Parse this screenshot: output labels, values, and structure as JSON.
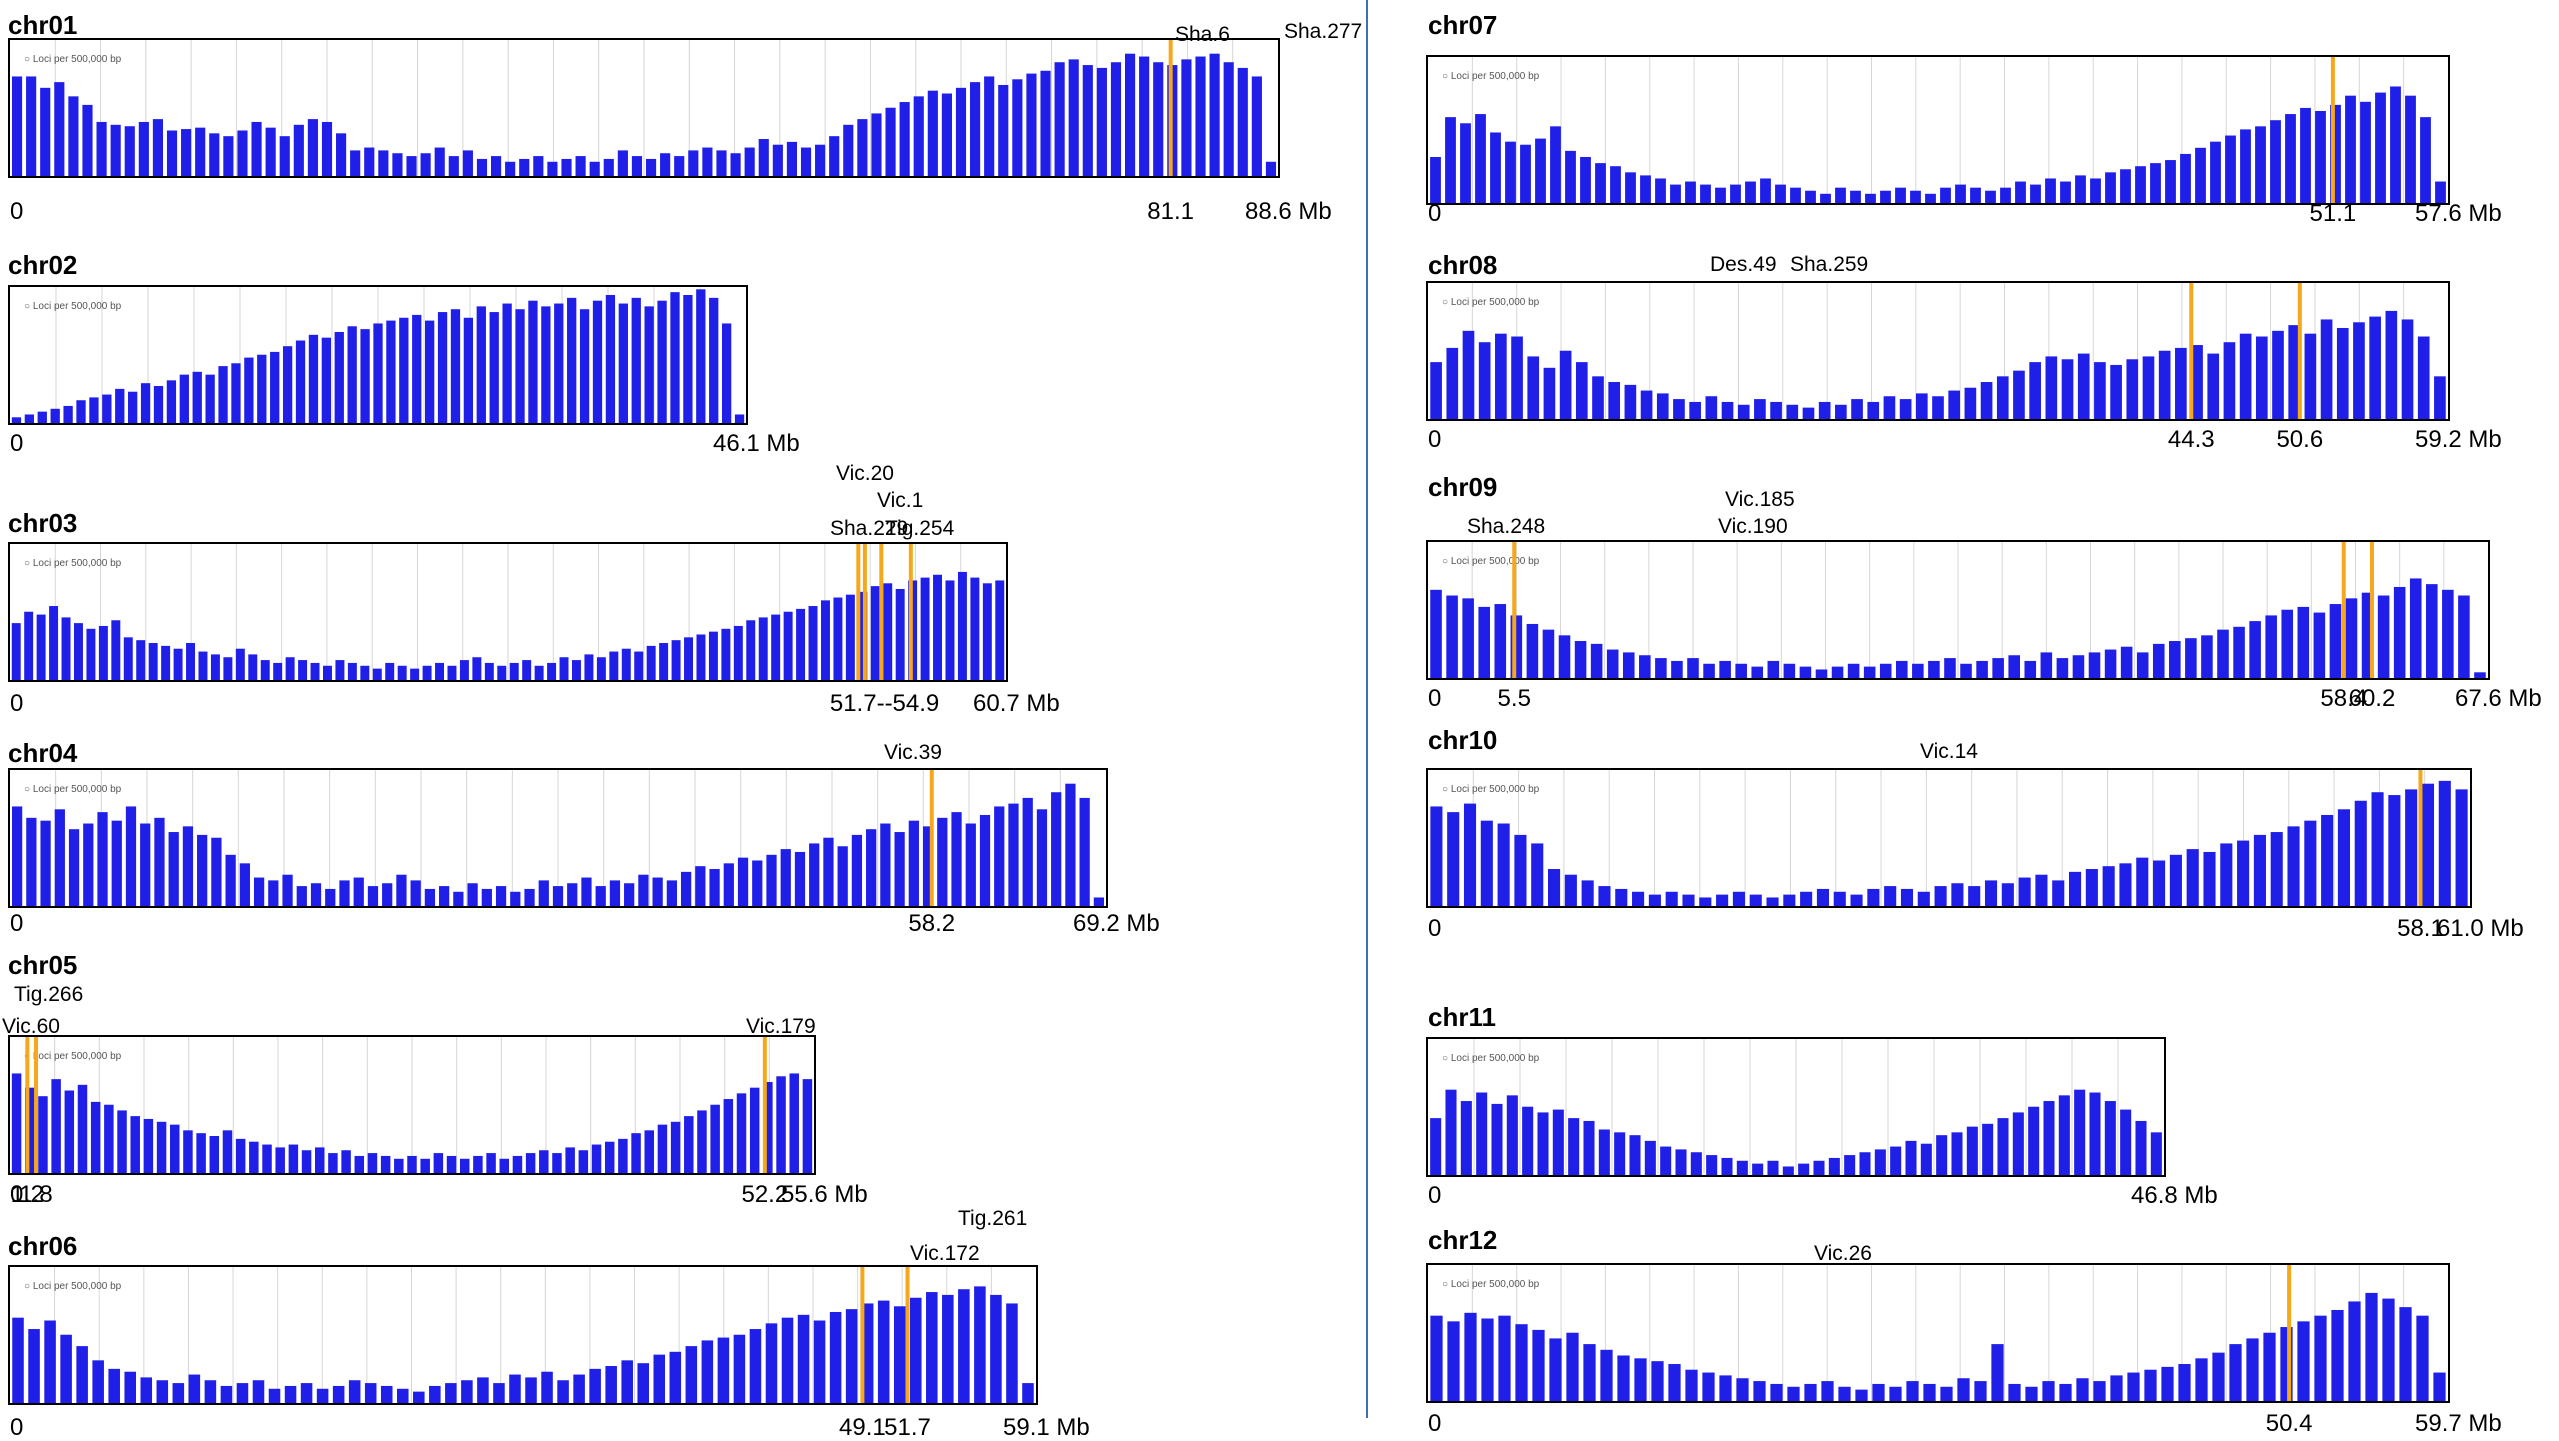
{
  "colors": {
    "bar": "#1f1fe8",
    "marker": "#f5a81c",
    "frame": "#000000",
    "grid": "#d6d6d6",
    "divider": "#3b6fb6"
  },
  "legend_text": "Loci per 500,000 bp",
  "unit": "Mb",
  "chart_data": [
    {
      "id": "chr01",
      "type": "bar",
      "title": "chr01",
      "length_mb": 88.6,
      "ticks": [
        "0",
        "81.1",
        "88.6 Mb"
      ],
      "tick_values": [
        0,
        81.1,
        88.6
      ],
      "markers": [
        {
          "label": "Sha.6",
          "position_mb": 81.1
        }
      ],
      "values": [
        70,
        70,
        62,
        66,
        56,
        50,
        38,
        36,
        35,
        38,
        40,
        32,
        33,
        34,
        30,
        28,
        32,
        38,
        34,
        28,
        36,
        40,
        38,
        30,
        18,
        20,
        18,
        16,
        14,
        16,
        20,
        14,
        18,
        12,
        14,
        10,
        12,
        14,
        10,
        12,
        14,
        10,
        12,
        18,
        14,
        12,
        16,
        14,
        18,
        20,
        18,
        16,
        20,
        26,
        22,
        24,
        20,
        22,
        28,
        36,
        40,
        44,
        48,
        52,
        56,
        60,
        58,
        62,
        66,
        70,
        64,
        68,
        72,
        74,
        80,
        82,
        78,
        76,
        80,
        86,
        84,
        80,
        78,
        82,
        84,
        86,
        80,
        76,
        70,
        10
      ]
    },
    {
      "id": "chr02",
      "type": "bar",
      "title": "chr02",
      "length_mb": 46.1,
      "ticks": [
        "0",
        "46.1 Mb"
      ],
      "tick_values": [
        0,
        46.1
      ],
      "markers": [],
      "values": [
        4,
        6,
        8,
        10,
        12,
        16,
        18,
        20,
        24,
        22,
        28,
        26,
        30,
        34,
        36,
        34,
        40,
        42,
        46,
        48,
        50,
        54,
        58,
        62,
        60,
        64,
        68,
        66,
        70,
        72,
        74,
        76,
        72,
        78,
        80,
        74,
        82,
        78,
        84,
        80,
        86,
        82,
        84,
        88,
        80,
        86,
        90,
        84,
        88,
        82,
        86,
        92,
        90,
        94,
        88,
        70,
        6
      ]
    },
    {
      "id": "chr03",
      "type": "bar",
      "title": "chr03",
      "length_mb": 60.7,
      "ticks": [
        "0",
        "51.7--54.9",
        "60.7 Mb"
      ],
      "tick_values": [
        0,
        53.3,
        60.7
      ],
      "markers": [
        {
          "label": "Vic.20",
          "position_mb": 51.7
        },
        {
          "label": "Vic.1",
          "position_mb": 52.1
        },
        {
          "label": "Sha.229",
          "position_mb": 53.1
        },
        {
          "label": "Tig.254",
          "position_mb": 54.9
        }
      ],
      "values": [
        40,
        48,
        46,
        52,
        44,
        40,
        36,
        38,
        42,
        30,
        28,
        26,
        24,
        22,
        26,
        20,
        18,
        16,
        22,
        18,
        14,
        12,
        16,
        14,
        12,
        10,
        14,
        12,
        10,
        8,
        12,
        10,
        8,
        10,
        12,
        10,
        14,
        16,
        12,
        10,
        12,
        14,
        10,
        12,
        16,
        14,
        18,
        16,
        20,
        22,
        20,
        24,
        26,
        28,
        30,
        32,
        34,
        36,
        38,
        42,
        44,
        46,
        48,
        50,
        52,
        56,
        58,
        60,
        62,
        66,
        68,
        64,
        70,
        72,
        74,
        70,
        76,
        72,
        68,
        70
      ]
    },
    {
      "id": "chr04",
      "type": "bar",
      "title": "chr04",
      "length_mb": 69.2,
      "ticks": [
        "0",
        "58.2",
        "69.2 Mb"
      ],
      "tick_values": [
        0,
        58.2,
        69.2
      ],
      "markers": [
        {
          "label": "Vic.39",
          "position_mb": 58.2
        }
      ],
      "values": [
        70,
        62,
        60,
        68,
        54,
        58,
        66,
        60,
        70,
        58,
        62,
        52,
        56,
        50,
        48,
        36,
        30,
        20,
        18,
        22,
        14,
        16,
        12,
        18,
        20,
        14,
        16,
        22,
        18,
        12,
        14,
        10,
        16,
        12,
        14,
        10,
        12,
        18,
        14,
        16,
        20,
        14,
        18,
        16,
        22,
        20,
        18,
        24,
        28,
        26,
        30,
        34,
        32,
        36,
        40,
        38,
        44,
        48,
        42,
        50,
        54,
        58,
        52,
        60,
        56,
        62,
        66,
        58,
        64,
        70,
        72,
        76,
        68,
        80,
        86,
        76,
        6
      ]
    },
    {
      "id": "chr05",
      "type": "bar",
      "title": "chr05",
      "length_mb": 55.6,
      "ticks": [
        "0",
        "1.2",
        "1.8",
        "52.2",
        "55.6 Mb"
      ],
      "tick_values": [
        0,
        1.2,
        1.8,
        52.2,
        55.6
      ],
      "markers": [
        {
          "label": "Vic.60",
          "position_mb": 1.2
        },
        {
          "label": "Tig.266",
          "position_mb": 1.8
        },
        {
          "label": "Vic.179",
          "position_mb": 52.2
        }
      ],
      "values": [
        70,
        60,
        54,
        66,
        58,
        62,
        50,
        48,
        44,
        40,
        38,
        36,
        34,
        30,
        28,
        26,
        30,
        24,
        22,
        20,
        18,
        20,
        16,
        18,
        14,
        16,
        12,
        14,
        12,
        10,
        12,
        10,
        14,
        12,
        10,
        12,
        14,
        10,
        12,
        14,
        16,
        14,
        18,
        16,
        20,
        22,
        24,
        28,
        30,
        34,
        36,
        40,
        44,
        48,
        52,
        56,
        60,
        64,
        68,
        70,
        66
      ]
    },
    {
      "id": "chr06",
      "type": "bar",
      "title": "chr06",
      "length_mb": 59.1,
      "ticks": [
        "0",
        "49.1",
        "51.7",
        "59.1 Mb"
      ],
      "tick_values": [
        0,
        49.1,
        51.7,
        59.1
      ],
      "markers": [
        {
          "label": "Vic.172",
          "position_mb": 49.1
        },
        {
          "label": "Tig.261",
          "position_mb": 51.7
        }
      ],
      "values": [
        60,
        52,
        58,
        48,
        40,
        30,
        24,
        22,
        18,
        16,
        14,
        20,
        16,
        12,
        14,
        16,
        10,
        12,
        14,
        10,
        12,
        16,
        14,
        12,
        10,
        8,
        12,
        14,
        16,
        18,
        14,
        20,
        18,
        22,
        16,
        20,
        24,
        26,
        30,
        28,
        34,
        36,
        40,
        44,
        46,
        48,
        52,
        56,
        60,
        62,
        58,
        64,
        66,
        70,
        72,
        68,
        74,
        78,
        76,
        80,
        82,
        76,
        70,
        14
      ]
    },
    {
      "id": "chr07",
      "type": "bar",
      "title": "chr07",
      "length_mb": 57.6,
      "ticks": [
        "0",
        "51.1",
        "57.6 Mb"
      ],
      "tick_values": [
        0,
        51.1,
        57.6
      ],
      "markers": [
        {
          "label": "Sha.277",
          "position_mb": 51.1
        }
      ],
      "values": [
        30,
        56,
        52,
        58,
        46,
        40,
        38,
        42,
        50,
        34,
        30,
        26,
        24,
        20,
        18,
        16,
        12,
        14,
        12,
        10,
        12,
        14,
        16,
        12,
        10,
        8,
        6,
        10,
        8,
        6,
        8,
        10,
        8,
        6,
        10,
        12,
        10,
        8,
        10,
        14,
        12,
        16,
        14,
        18,
        16,
        20,
        22,
        24,
        26,
        28,
        32,
        36,
        40,
        44,
        48,
        50,
        54,
        58,
        62,
        60,
        64,
        70,
        66,
        72,
        76,
        70,
        56,
        14
      ]
    },
    {
      "id": "chr08",
      "type": "bar",
      "title": "chr08",
      "length_mb": 59.2,
      "ticks": [
        "0",
        "44.3",
        "50.6",
        "59.2 Mb"
      ],
      "tick_values": [
        0,
        44.3,
        50.6,
        59.2
      ],
      "markers": [
        {
          "label": "Des.49",
          "position_mb": 44.3
        },
        {
          "label": "Sha.259",
          "position_mb": 50.6
        }
      ],
      "values": [
        40,
        50,
        62,
        54,
        60,
        58,
        44,
        36,
        48,
        40,
        30,
        26,
        24,
        20,
        18,
        14,
        12,
        16,
        12,
        10,
        14,
        12,
        10,
        8,
        12,
        10,
        14,
        12,
        16,
        14,
        18,
        16,
        20,
        22,
        26,
        30,
        34,
        40,
        44,
        42,
        46,
        40,
        38,
        42,
        44,
        48,
        50,
        52,
        46,
        54,
        60,
        58,
        62,
        66,
        60,
        70,
        64,
        68,
        72,
        76,
        70,
        58,
        30
      ]
    },
    {
      "id": "chr09",
      "type": "bar",
      "title": "chr09",
      "length_mb": 67.6,
      "ticks": [
        "0",
        "5.5",
        "58.4",
        "60.2",
        "67.6 Mb"
      ],
      "tick_values": [
        0,
        5.5,
        58.4,
        60.2,
        67.6
      ],
      "markers": [
        {
          "label": "Sha.248",
          "position_mb": 5.5
        },
        {
          "label": "Vic.185",
          "position_mb": 60.2
        },
        {
          "label": "Vic.190",
          "position_mb": 58.4
        }
      ],
      "values": [
        62,
        58,
        56,
        50,
        52,
        44,
        38,
        34,
        30,
        26,
        24,
        20,
        18,
        16,
        14,
        12,
        14,
        10,
        12,
        10,
        8,
        12,
        10,
        8,
        6,
        8,
        10,
        8,
        10,
        12,
        10,
        12,
        14,
        10,
        12,
        14,
        16,
        12,
        18,
        14,
        16,
        18,
        20,
        22,
        18,
        24,
        26,
        28,
        30,
        34,
        36,
        40,
        44,
        48,
        50,
        46,
        52,
        56,
        60,
        58,
        64,
        70,
        66,
        62,
        58,
        4
      ]
    },
    {
      "id": "chr10",
      "type": "bar",
      "title": "chr10",
      "length_mb": 61.0,
      "ticks": [
        "0",
        "58.1",
        "61.0 Mb"
      ],
      "tick_values": [
        0,
        58.1,
        61.0
      ],
      "markers": [
        {
          "label": "Vic.14",
          "position_mb": 58.1
        }
      ],
      "values": [
        70,
        66,
        72,
        60,
        58,
        50,
        44,
        26,
        22,
        18,
        14,
        12,
        10,
        8,
        10,
        8,
        6,
        8,
        10,
        8,
        6,
        8,
        10,
        12,
        10,
        8,
        12,
        14,
        12,
        10,
        14,
        16,
        14,
        18,
        16,
        20,
        22,
        18,
        24,
        26,
        28,
        30,
        34,
        32,
        36,
        40,
        38,
        44,
        46,
        50,
        52,
        56,
        60,
        64,
        68,
        74,
        80,
        78,
        82,
        86,
        88,
        82
      ]
    },
    {
      "id": "chr11",
      "type": "bar",
      "title": "chr11",
      "length_mb": 46.8,
      "ticks": [
        "0",
        "46.8 Mb"
      ],
      "tick_values": [
        0,
        46.8
      ],
      "markers": [],
      "values": [
        40,
        60,
        52,
        58,
        50,
        56,
        48,
        44,
        46,
        40,
        38,
        32,
        30,
        28,
        24,
        20,
        18,
        16,
        14,
        12,
        10,
        8,
        10,
        6,
        8,
        10,
        12,
        14,
        16,
        18,
        20,
        24,
        22,
        28,
        30,
        34,
        36,
        40,
        44,
        48,
        52,
        56,
        60,
        58,
        52,
        46,
        38,
        30
      ]
    },
    {
      "id": "chr12",
      "type": "bar",
      "title": "chr12",
      "length_mb": 59.7,
      "ticks": [
        "0",
        "50.4",
        "59.7 Mb"
      ],
      "tick_values": [
        0,
        50.4,
        59.7
      ],
      "markers": [
        {
          "label": "Vic.26",
          "position_mb": 50.4
        }
      ],
      "values": [
        60,
        56,
        62,
        58,
        60,
        54,
        50,
        44,
        48,
        40,
        36,
        32,
        30,
        28,
        26,
        22,
        20,
        18,
        16,
        14,
        12,
        10,
        12,
        14,
        10,
        8,
        12,
        10,
        14,
        12,
        10,
        16,
        14,
        40,
        12,
        10,
        14,
        12,
        16,
        14,
        18,
        20,
        22,
        24,
        26,
        30,
        34,
        40,
        44,
        48,
        52,
        56,
        60,
        64,
        70,
        76,
        72,
        66,
        60,
        20
      ]
    }
  ]
}
